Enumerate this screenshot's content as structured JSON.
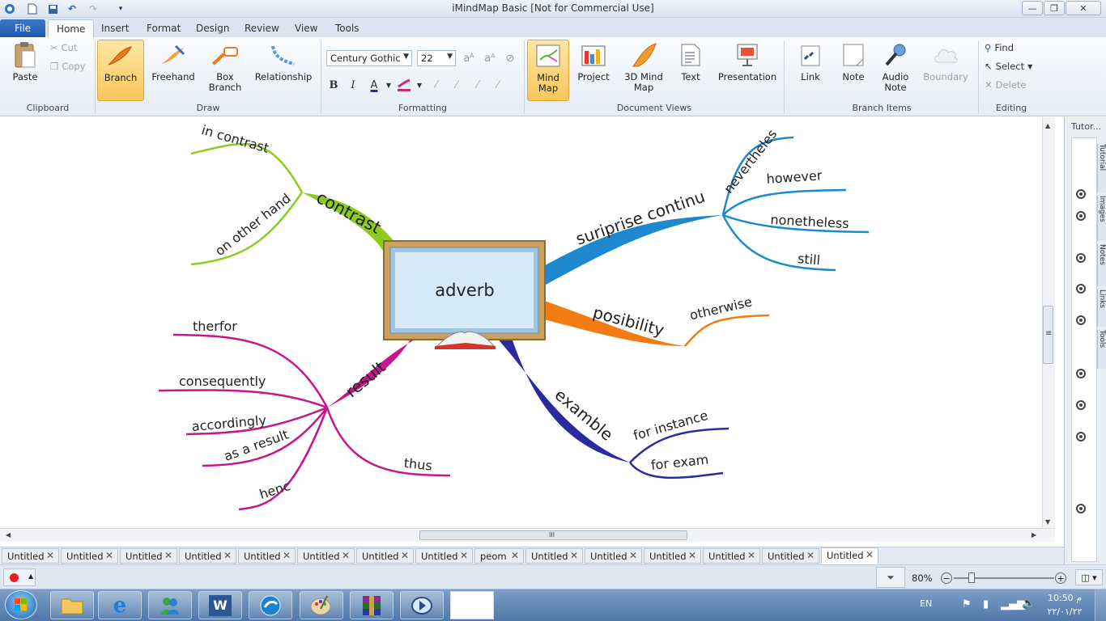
{
  "window": {
    "title": "iMindMap Basic [Not for Commercial Use]",
    "minimize": "—",
    "maximize": "❐",
    "close": "✕"
  },
  "ribbon_tabs": [
    "File",
    "Home",
    "Insert",
    "Format",
    "Design",
    "Review",
    "View",
    "Tools"
  ],
  "ribbon": {
    "clipboard": {
      "paste": "Paste",
      "cut": "Cut",
      "copy": "Copy",
      "label": "Clipboard"
    },
    "draw": {
      "branch": "Branch",
      "freehand": "Freehand",
      "box_branch_1": "Box",
      "box_branch_2": "Branch",
      "relationship": "Relationship",
      "label": "Draw"
    },
    "formatting": {
      "font": "Century Gothic",
      "size": "22",
      "label": "Formatting",
      "bold": "B",
      "italic": "I",
      "color": "A"
    },
    "document_views": {
      "mindmap_1": "Mind",
      "mindmap_2": "Map",
      "project": "Project",
      "mind3d_1": "3D Mind",
      "mind3d_2": "Map",
      "text": "Text",
      "presentation": "Presentation",
      "label": "Document Views"
    },
    "branch_items": {
      "link": "Link",
      "note": "Note",
      "audio_1": "Audio",
      "audio_2": "Note",
      "boundary": "Boundary",
      "label": "Branch Items"
    },
    "editing": {
      "find": "Find",
      "select": "Select",
      "delete": "Delete",
      "label": "Editing"
    }
  },
  "mindmap": {
    "central": "adverb",
    "branches": {
      "contrast": {
        "label": "contrast",
        "color": "#8ccc1e",
        "children": [
          "in contrast",
          "on other hand"
        ]
      },
      "surprise": {
        "label": "suriprise continu",
        "color": "#1e88cf",
        "children": [
          "nevertheles",
          "however",
          "nonetheless",
          "still"
        ]
      },
      "possibility": {
        "label": "posibility",
        "color": "#f27b12",
        "children": [
          "otherwise"
        ]
      },
      "example": {
        "label": "examble",
        "color": "#2a2aa0",
        "children": [
          "for instance",
          "for exam"
        ]
      },
      "result": {
        "label": "result",
        "color": "#c8158e",
        "children": [
          "therfor",
          "consequently",
          "accordingly",
          "as a result",
          "henc",
          "thus"
        ]
      }
    }
  },
  "side_panel": {
    "header": "Tutor...",
    "tabs": [
      "Tutorial",
      "Images",
      "Notes",
      "Links",
      "Tools"
    ]
  },
  "doc_tabs": [
    "Untitled",
    "Untitled",
    "Untitled",
    "Untitled",
    "Untitled",
    "Untitled",
    "Untitled",
    "Untitled",
    "peom",
    "Untitled",
    "Untitled",
    "Untitled",
    "Untitled",
    "Untitled",
    "Untitled"
  ],
  "status": {
    "zoom": "80%"
  },
  "taskbar": {
    "lang": "EN",
    "time": "10:50 م",
    "date": "٢٢/٠١/٢٢"
  },
  "scroll": {
    "v_grip": "≡",
    "h_grip": "III"
  }
}
